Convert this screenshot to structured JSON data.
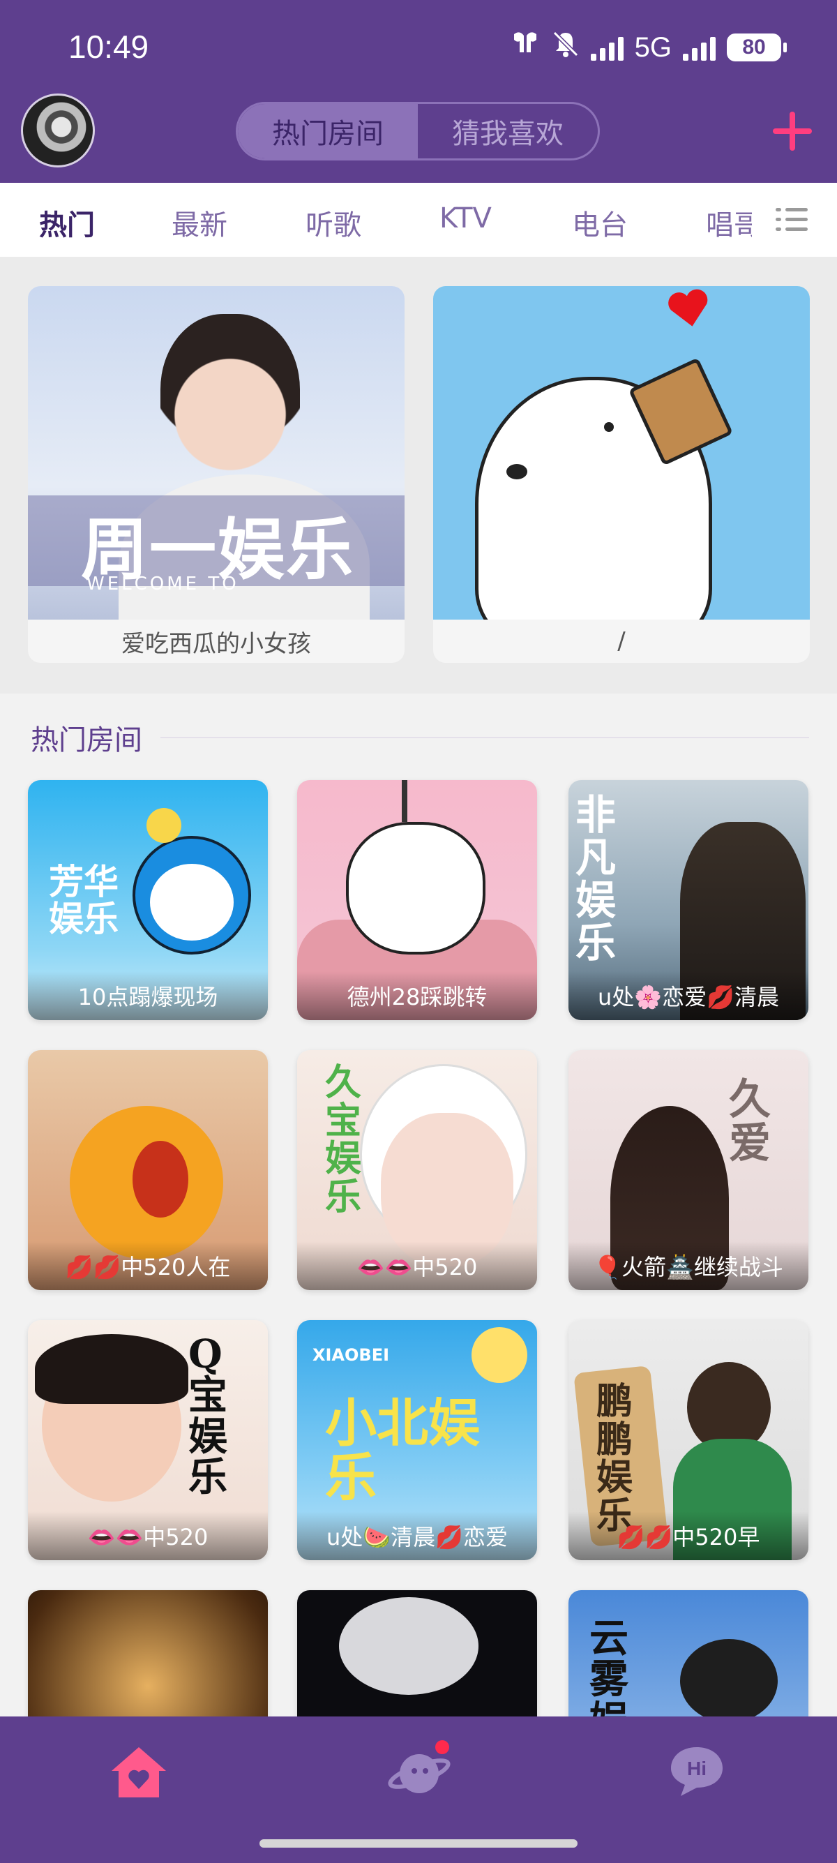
{
  "status_bar": {
    "time": "10:49",
    "network": "5G",
    "battery": "80"
  },
  "header": {
    "segments": [
      "热门房间",
      "猜我喜欢"
    ],
    "active_segment": 0,
    "accent": "#5e3f8e",
    "plus_color": "#ff3e7f"
  },
  "categories": {
    "items": [
      "热门",
      "最新",
      "听歌",
      "KTV",
      "电台",
      "唱哥"
    ],
    "active": 0
  },
  "featured": [
    {
      "caption": "爱吃西瓜的小女孩",
      "art_title": "周一娱乐",
      "art_sub": "WELCOME TO"
    },
    {
      "caption": "/"
    }
  ],
  "hot_rooms": {
    "title": "热门房间",
    "rooms": [
      {
        "caption": "10点蹋爆现场",
        "art": "芳华娱乐"
      },
      {
        "caption": "德州28踩跳转",
        "art": ""
      },
      {
        "caption": "u处🌸恋爱💋清晨",
        "art": "非凡娱乐"
      },
      {
        "caption": "💋💋中520人在",
        "art": ""
      },
      {
        "caption": "👄👄中520",
        "art": "久宝娱乐"
      },
      {
        "caption": "🎈火箭🏯继续战斗",
        "art": "久爱"
      },
      {
        "caption": "👄👄中520",
        "art": "Q宝娱乐"
      },
      {
        "caption": "u处🍉清晨💋恋爱",
        "art": "小北娱乐",
        "art_sub": "XIAOBEI"
      },
      {
        "caption": "💋💋中520早",
        "art": "鹏鹏娱乐"
      },
      {
        "caption": "",
        "art": ""
      },
      {
        "caption": "",
        "art": ""
      },
      {
        "caption": "",
        "art": "云雾娱"
      }
    ]
  },
  "bottom_nav": {
    "items": [
      "home-icon",
      "planet-icon",
      "hi-icon"
    ],
    "hi_label": "Hi",
    "active": 0
  }
}
